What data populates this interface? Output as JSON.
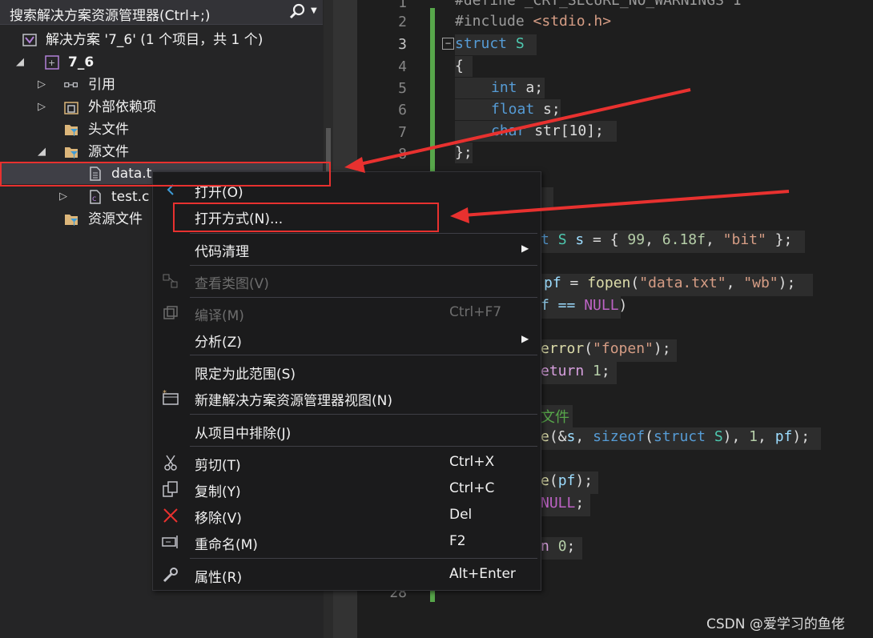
{
  "explorer": {
    "search_placeholder": "搜索解决方案资源管理器(Ctrl+;)",
    "tree": [
      {
        "label": "解决方案 '7_6' (1 个项目，共 1 个)",
        "icon": "solution-icon"
      },
      {
        "label": "7_6",
        "icon": "project-icon"
      },
      {
        "label": "引用",
        "icon": "references-icon"
      },
      {
        "label": "外部依赖项",
        "icon": "external-deps-icon"
      },
      {
        "label": "头文件",
        "icon": "filter-folder-icon"
      },
      {
        "label": "源文件",
        "icon": "filter-folder-icon"
      },
      {
        "label": "data.t",
        "icon": "text-file-icon"
      },
      {
        "label": "test.c",
        "icon": "c-file-icon"
      },
      {
        "label": "资源文件",
        "icon": "filter-folder-icon"
      }
    ]
  },
  "editor": {
    "line_numbers": [
      "1",
      "2",
      "3",
      "4",
      "5",
      "6",
      "7",
      "8",
      "28"
    ],
    "code": {
      "l1": "#define _CRT_SECURE_NO_WARNINGS 1",
      "l2a": "#include ",
      "l2b": "<stdio.h>",
      "l3a": "struct",
      "l3b": " S",
      "l4": "{",
      "l5a": "int",
      "l5b": " a;",
      "l6a": "float",
      "l6b": " s;",
      "l7a": "char",
      "l7b": " str[10];",
      "l8": "};",
      "s1a": "t ",
      "s1b": "S",
      "s1c": " s",
      "s1d": " = { ",
      "s1e": "99",
      "s1f": ", ",
      "s1g": "6.18f",
      "s1h": ", ",
      "s1i": "\"bit\"",
      "s1j": " };",
      "s2a": "pf",
      "s2b": " = ",
      "s2c": "fopen",
      "s2d": "(",
      "s2e": "\"data.txt\"",
      "s2f": ", ",
      "s2g": "\"wb\"",
      "s2h": ");",
      "s3a": "f == ",
      "s3b": "NULL",
      "s3c": ")",
      "s4a": "error",
      "s4b": "(",
      "s4c": "\"fopen\"",
      "s4d": ");",
      "s5a": "eturn",
      "s5b": " ",
      "s5c": "1",
      "s5d": ";",
      "s6": "文件",
      "s7a": "e",
      "s7b": "(&",
      "s7c": "s",
      "s7d": ", ",
      "s7e": "sizeof",
      "s7f": "(",
      "s7g": "struct",
      "s7h": " ",
      "s7i": "S",
      "s7j": "), ",
      "s7k": "1",
      "s7l": ", ",
      "s7m": "pf",
      "s7n": ");",
      "s8a": "e",
      "s8b": "(",
      "s8c": "pf",
      "s8d": ");",
      "s9a": "NULL",
      "s9b": ";",
      "s10a": "n",
      "s10b": " ",
      "s10c": "0",
      "s10d": ";"
    }
  },
  "context_menu": {
    "items": [
      {
        "label": "打开(O)",
        "icon": "open-icon",
        "enabled": true
      },
      {
        "label": "打开方式(N)...",
        "enabled": true
      },
      {
        "label": "代码清理",
        "submenu": true,
        "enabled": true
      },
      {
        "label": "查看类图(V)",
        "icon": "class-diagram-icon",
        "enabled": false
      },
      {
        "label": "编译(M)",
        "shortcut": "Ctrl+F7",
        "icon": "compile-icon",
        "enabled": false
      },
      {
        "label": "分析(Z)",
        "submenu": true,
        "enabled": true
      },
      {
        "label": "限定为此范围(S)",
        "enabled": true
      },
      {
        "label": "新建解决方案资源管理器视图(N)",
        "icon": "new-view-icon",
        "enabled": true
      },
      {
        "label": "从项目中排除(J)",
        "enabled": true
      },
      {
        "label": "剪切(T)",
        "shortcut": "Ctrl+X",
        "icon": "cut-icon",
        "enabled": true
      },
      {
        "label": "复制(Y)",
        "shortcut": "Ctrl+C",
        "icon": "copy-icon",
        "enabled": true
      },
      {
        "label": "移除(V)",
        "shortcut": "Del",
        "icon": "remove-icon",
        "enabled": true
      },
      {
        "label": "重命名(M)",
        "shortcut": "F2",
        "icon": "rename-icon",
        "enabled": true
      },
      {
        "label": "属性(R)",
        "shortcut": "Alt+Enter",
        "icon": "wrench-icon",
        "enabled": true
      }
    ]
  },
  "watermark": "CSDN @爱学习的鱼佬",
  "colors": {
    "annotation": "#e8312f",
    "keyword": "#569cd6",
    "type": "#4ec9b0",
    "string": "#d69d85",
    "change_bar": "#57a64a"
  }
}
